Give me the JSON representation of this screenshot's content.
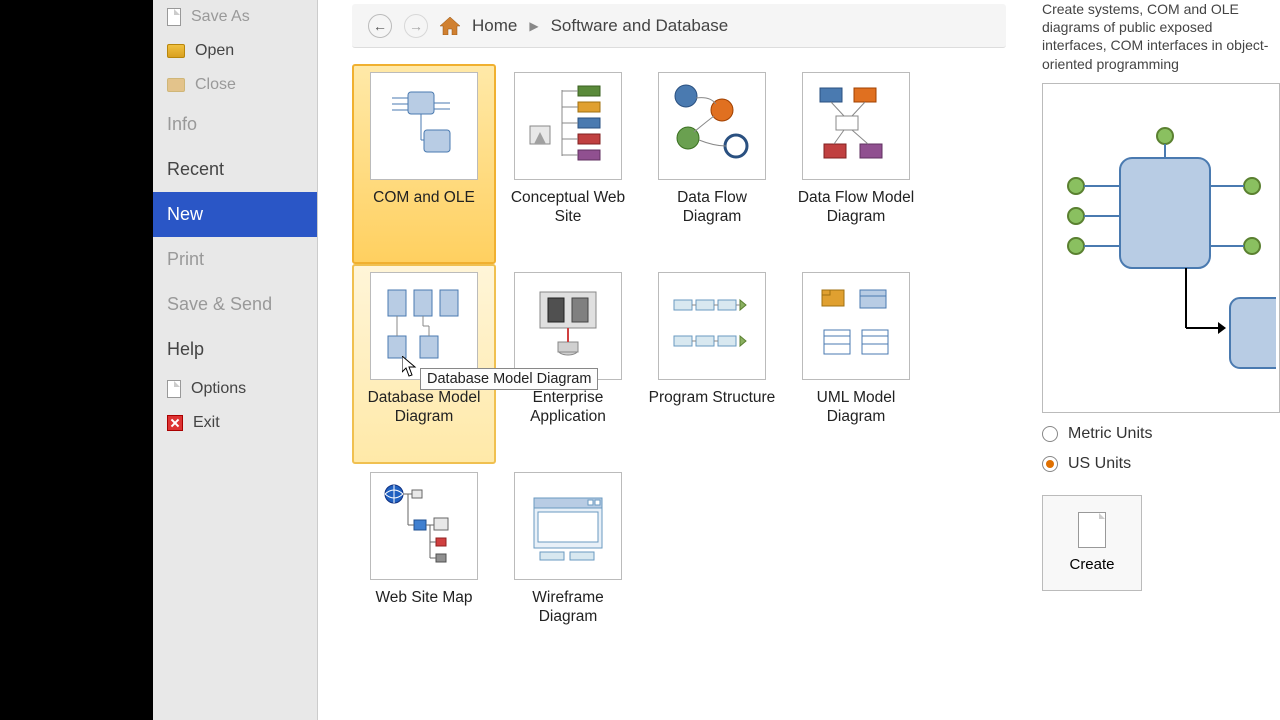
{
  "sidebar": {
    "save_as": "Save As",
    "open": "Open",
    "close": "Close",
    "info": "Info",
    "recent": "Recent",
    "new": "New",
    "print": "Print",
    "save_send": "Save & Send",
    "help": "Help",
    "options": "Options",
    "exit": "Exit"
  },
  "breadcrumb": {
    "home": "Home",
    "current": "Software and Database"
  },
  "templates": [
    {
      "label": "COM and OLE"
    },
    {
      "label": "Conceptual Web Site"
    },
    {
      "label": "Data Flow Diagram"
    },
    {
      "label": "Data Flow Model Diagram"
    },
    {
      "label": "Database Model Diagram"
    },
    {
      "label": "Enterprise Application"
    },
    {
      "label": "Program Structure"
    },
    {
      "label": "UML Model Diagram"
    },
    {
      "label": "Web Site Map"
    },
    {
      "label": "Wireframe Diagram"
    }
  ],
  "tooltip": "Database Model Diagram",
  "description": "Create systems, COM and OLE diagrams of public exposed interfaces, COM interfaces in object-oriented programming",
  "units": {
    "metric": "Metric Units",
    "us": "US Units"
  },
  "create": "Create"
}
